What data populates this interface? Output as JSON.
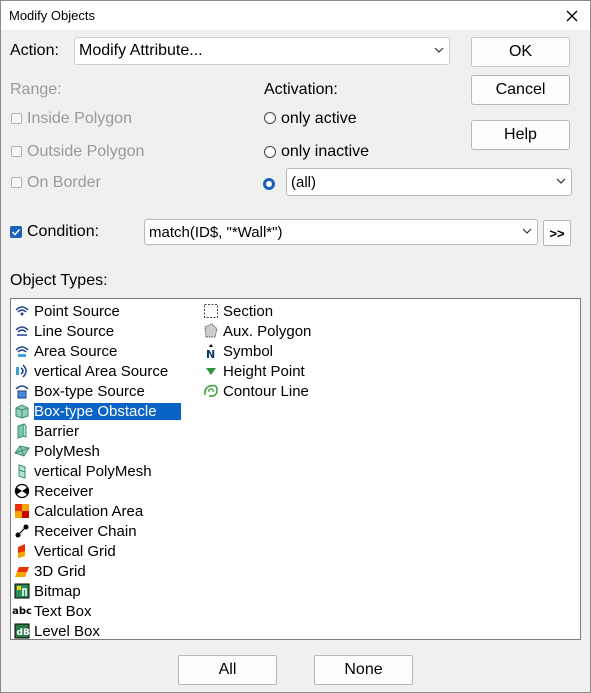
{
  "window": {
    "title": "Modify Objects"
  },
  "action": {
    "label": "Action:",
    "value": "Modify Attribute..."
  },
  "buttons": {
    "ok": "OK",
    "cancel": "Cancel",
    "help": "Help",
    "all": "All",
    "none": "None",
    "more": ">>"
  },
  "range": {
    "label": "Range:",
    "inside_polygon": "Inside Polygon",
    "outside_polygon": "Outside Polygon",
    "on_border": "On Border"
  },
  "activation": {
    "label": "Activation:",
    "only_active": "only active",
    "only_inactive": "only inactive",
    "selected_value": "(all)"
  },
  "condition": {
    "label": "Condition:",
    "checked": true,
    "value": "match(ID$, \"*Wall*\")"
  },
  "object_types": {
    "label": "Object Types:",
    "column1": [
      {
        "label": "Point Source",
        "icon": "point-source-icon"
      },
      {
        "label": "Line Source",
        "icon": "line-source-icon"
      },
      {
        "label": "Area Source",
        "icon": "area-source-icon"
      },
      {
        "label": "vertical Area Source",
        "icon": "vertical-area-source-icon"
      },
      {
        "label": "Box-type Source",
        "icon": "box-type-source-icon"
      },
      {
        "label": "Box-type Obstacle",
        "icon": "box-type-obstacle-icon",
        "selected": true
      },
      {
        "label": "Barrier",
        "icon": "barrier-icon"
      },
      {
        "label": "PolyMesh",
        "icon": "polymesh-icon"
      },
      {
        "label": "vertical PolyMesh",
        "icon": "vertical-polymesh-icon"
      },
      {
        "label": "Receiver",
        "icon": "receiver-icon"
      },
      {
        "label": "Calculation Area",
        "icon": "calculation-area-icon"
      },
      {
        "label": "Receiver Chain",
        "icon": "receiver-chain-icon"
      },
      {
        "label": "Vertical Grid",
        "icon": "vertical-grid-icon"
      },
      {
        "label": "3D Grid",
        "icon": "3d-grid-icon"
      },
      {
        "label": "Bitmap",
        "icon": "bitmap-icon"
      },
      {
        "label": "Text Box",
        "icon": "text-box-icon"
      },
      {
        "label": "Level Box",
        "icon": "level-box-icon"
      }
    ],
    "column2": [
      {
        "label": "Section",
        "icon": "section-icon"
      },
      {
        "label": "Aux. Polygon",
        "icon": "aux-polygon-icon"
      },
      {
        "label": "Symbol",
        "icon": "symbol-icon"
      },
      {
        "label": "Height Point",
        "icon": "height-point-icon"
      },
      {
        "label": "Contour Line",
        "icon": "contour-line-icon"
      }
    ]
  },
  "colors": {
    "accent": "#0a64c8",
    "disabled_text": "#9a9a9a",
    "background": "#f0f0f0"
  }
}
